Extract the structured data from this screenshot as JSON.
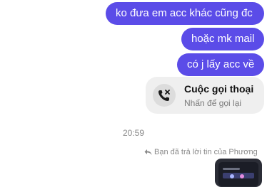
{
  "messages": [
    {
      "text": "ko đưa em acc khác cũng đc"
    },
    {
      "text": "hoặc mk mail"
    },
    {
      "text": "có j lấy acc về"
    }
  ],
  "call": {
    "title": "Cuộc gọi thoại",
    "subtitle": "Nhấn để gọi lại",
    "icon": "missed-call-icon"
  },
  "timestamp": "20:59",
  "reply_note": {
    "text": "Bạn đã trả lời tin của Phương",
    "icon": "reply-arrow-icon"
  },
  "thumbnail": {
    "icon": "shared-screenshot-thumbnail"
  },
  "colors": {
    "bubble": "#5b4ce8",
    "call_card_bg": "#efefef",
    "muted_text": "#8a8a8a"
  }
}
